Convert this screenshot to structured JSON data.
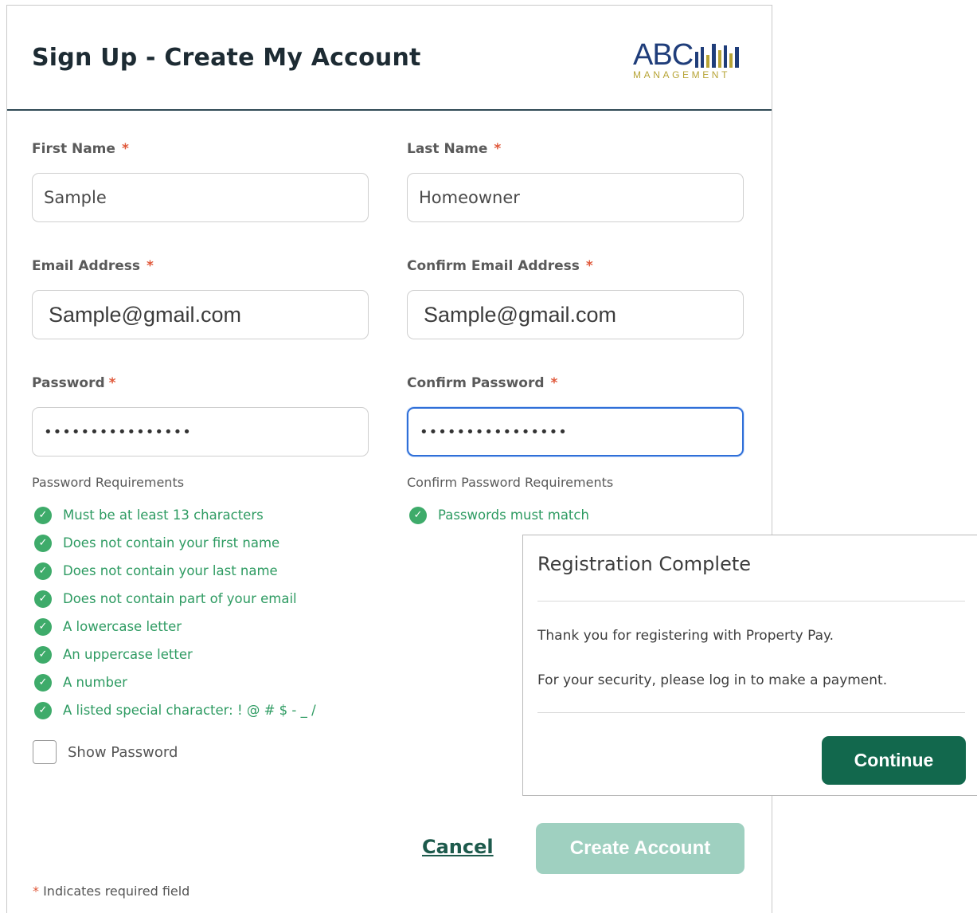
{
  "header": {
    "title": "Sign Up - Create My Account",
    "logo_text": "ABC",
    "logo_subtext": "MANAGEMENT"
  },
  "form": {
    "first_name": {
      "label": "First Name",
      "required_mark": "*",
      "value": "Sample"
    },
    "last_name": {
      "label": "Last Name",
      "required_mark": "*",
      "value": "Homeowner"
    },
    "email": {
      "label": "Email Address",
      "required_mark": "*",
      "value": "Sample@gmail.com"
    },
    "confirm_email": {
      "label": "Confirm Email Address",
      "required_mark": "*",
      "value": "Sample@gmail.com"
    },
    "password": {
      "label": "Password",
      "required_mark": "*",
      "value": "••••••••••••••••"
    },
    "confirm_password": {
      "label": "Confirm Password",
      "required_mark": "*",
      "value": "••••••••••••••••"
    }
  },
  "password_requirements": {
    "title": "Password Requirements",
    "items": [
      "Must be at least 13 characters",
      "Does not contain your first name",
      "Does not contain your last name",
      "Does not contain part of your email",
      "A lowercase letter",
      "An uppercase letter",
      "A number",
      "A listed special character:  ! @ # $ - _ /"
    ]
  },
  "confirm_requirements": {
    "title": "Confirm Password Requirements",
    "items": [
      "Passwords must match"
    ]
  },
  "show_password": {
    "label": "Show Password",
    "checked": false
  },
  "actions": {
    "cancel_label": "Cancel",
    "create_label": "Create Account"
  },
  "footer": {
    "required_star": "*",
    "required_note": " Indicates required field"
  },
  "modal": {
    "title": "Registration Complete",
    "message1": "Thank you for registering with Property Pay.",
    "message2": "For your security, please log in to make a payment.",
    "continue_label": "Continue"
  },
  "colors": {
    "accent_green": "#12684d",
    "disabled_button": "#9fd0c0",
    "check_green": "#3eab6a",
    "required_red": "#e0583a",
    "focus_blue": "#2f6fd8"
  },
  "icons": {
    "check": "check-circle-icon"
  }
}
